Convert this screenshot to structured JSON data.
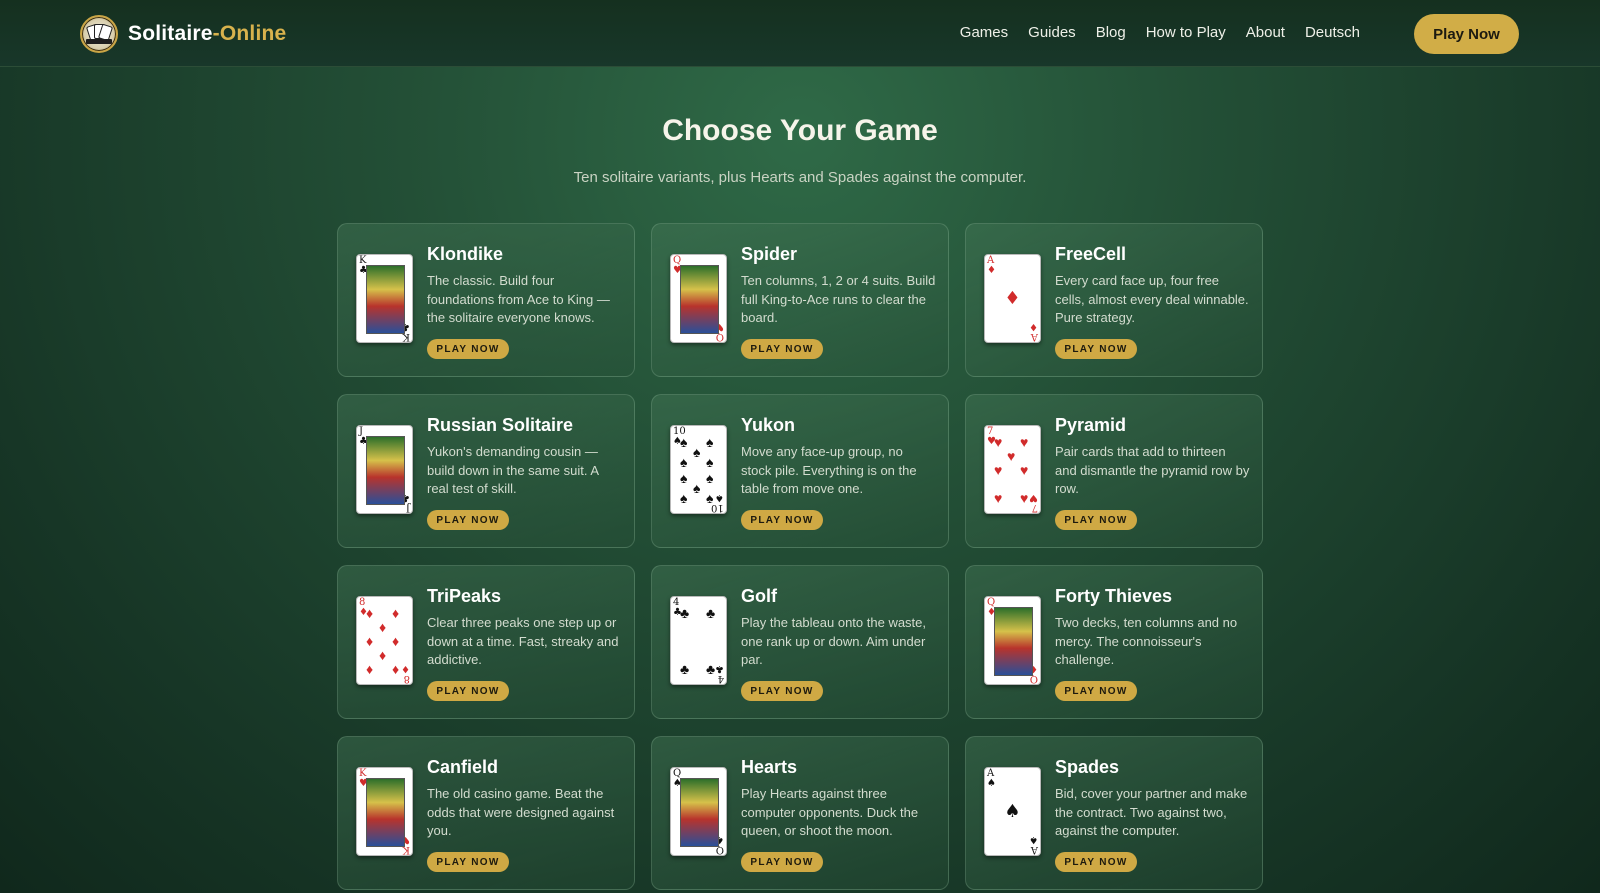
{
  "header": {
    "logo_main": "Solitaire",
    "logo_accent": "-Online",
    "nav": [
      "Games",
      "Guides",
      "Blog",
      "How to Play",
      "About",
      "Deutsch"
    ],
    "play_label": "Play Now"
  },
  "hero": {
    "title": "Choose Your Game",
    "subtitle": "Ten solitaire variants, plus Hearts and Spades against the computer."
  },
  "cta_label": "PLAY NOW",
  "games": [
    {
      "title": "Klondike",
      "desc": "The classic. Build four foundations from Ace to King — the solitaire everyone knows.",
      "rank": "K",
      "suit": "♣",
      "color": "black",
      "card_type": "face"
    },
    {
      "title": "Spider",
      "desc": "Ten columns, 1, 2 or 4 suits. Build full King-to-Ace runs to clear the board.",
      "rank": "Q",
      "suit": "♥",
      "color": "red",
      "card_type": "face"
    },
    {
      "title": "FreeCell",
      "desc": "Every card face up, four free cells, almost every deal winnable. Pure strategy.",
      "rank": "A",
      "suit": "♦",
      "color": "red",
      "card_type": "ace"
    },
    {
      "title": "Russian Solitaire",
      "desc": "Yukon's demanding cousin — build down in the same suit. A real test of skill.",
      "rank": "J",
      "suit": "♣",
      "color": "black",
      "card_type": "face"
    },
    {
      "title": "Yukon",
      "desc": "Move any face-up group, no stock pile. Everything is on the table from move one.",
      "rank": "10",
      "suit": "♠",
      "color": "black",
      "card_type": "pips",
      "pip_count": 10
    },
    {
      "title": "Pyramid",
      "desc": "Pair cards that add to thirteen and dismantle the pyramid row by row.",
      "rank": "7",
      "suit": "♥",
      "color": "red",
      "card_type": "pips",
      "pip_count": 7
    },
    {
      "title": "TriPeaks",
      "desc": "Clear three peaks one step up or down at a time. Fast, streaky and addictive.",
      "rank": "8",
      "suit": "♦",
      "color": "red",
      "card_type": "pips",
      "pip_count": 8
    },
    {
      "title": "Golf",
      "desc": "Play the tableau onto the waste, one rank up or down. Aim under par.",
      "rank": "4",
      "suit": "♣",
      "color": "black",
      "card_type": "pips",
      "pip_count": 4
    },
    {
      "title": "Forty Thieves",
      "desc": "Two decks, ten columns and no mercy. The connoisseur's challenge.",
      "rank": "Q",
      "suit": "♦",
      "color": "red",
      "card_type": "face"
    },
    {
      "title": "Canfield",
      "desc": "The old casino game. Beat the odds that were designed against you.",
      "rank": "K",
      "suit": "♥",
      "color": "red",
      "card_type": "face"
    },
    {
      "title": "Hearts",
      "desc": "Play Hearts against three computer opponents. Duck the queen, or shoot the moon.",
      "rank": "Q",
      "suit": "♠",
      "color": "black",
      "card_type": "face"
    },
    {
      "title": "Spades",
      "desc": "Bid, cover your partner and make the contract. Two against two, against the computer.",
      "rank": "A",
      "suit": "♠",
      "color": "black",
      "card_type": "ace"
    }
  ],
  "colors": {
    "accent_gold": "#d1ad47",
    "background_green": "#234f36",
    "card_red": "#d12b2b"
  }
}
